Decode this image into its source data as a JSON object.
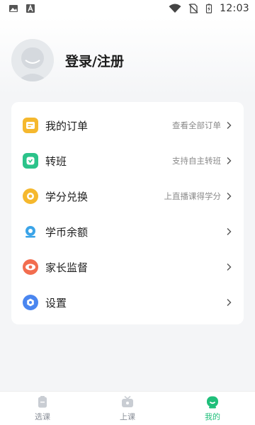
{
  "status_bar": {
    "time": "12:03",
    "left_icons": [
      "image-icon",
      "a-letter-icon"
    ],
    "right_icons": [
      "wifi-icon",
      "no-sim-icon",
      "battery-charging-icon"
    ]
  },
  "profile": {
    "login_label": "登录/注册"
  },
  "menu": {
    "items": [
      {
        "label": "我的订单",
        "hint": "查看全部订单",
        "icon": "order-icon",
        "color": "#f5b82e"
      },
      {
        "label": "转班",
        "hint": "支持自主转班",
        "icon": "transfer-class-icon",
        "color": "#2bc38a"
      },
      {
        "label": "学分兑换",
        "hint": "上直播课得学分",
        "icon": "credit-exchange-icon",
        "color": "#f5b82e"
      },
      {
        "label": "学币余额",
        "hint": "",
        "icon": "coin-balance-icon",
        "color": "#3ba4e8"
      },
      {
        "label": "家长监督",
        "hint": "",
        "icon": "parent-supervision-icon",
        "color": "#f26d4f"
      },
      {
        "label": "设置",
        "hint": "",
        "icon": "settings-icon",
        "color": "#4a86f0"
      }
    ]
  },
  "tab_bar": {
    "tabs": [
      {
        "label": "选课",
        "icon": "course-select-icon",
        "active": false
      },
      {
        "label": "上课",
        "icon": "class-tv-icon",
        "active": false
      },
      {
        "label": "我的",
        "icon": "profile-face-icon",
        "active": true
      }
    ],
    "active_color": "#1fbf7a",
    "inactive_color": "#8a8f98"
  }
}
